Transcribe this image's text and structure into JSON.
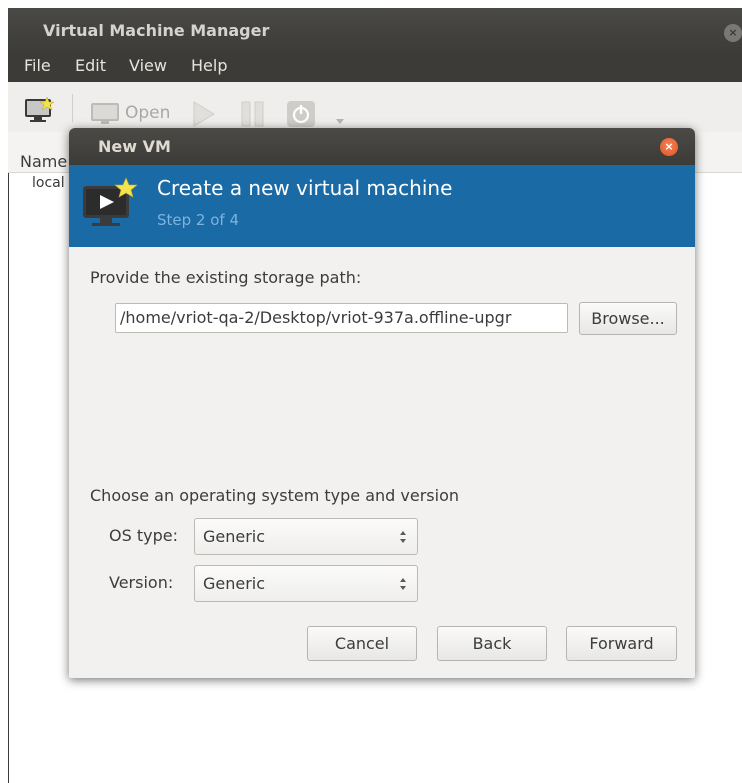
{
  "window": {
    "title": "Virtual Machine Manager",
    "close_glyph": "×"
  },
  "menubar": {
    "items": [
      {
        "label": "File"
      },
      {
        "label": "Edit"
      },
      {
        "label": "View"
      },
      {
        "label": "Help"
      }
    ]
  },
  "toolbar": {
    "open_label": "Open",
    "icons": [
      "new-vm-icon",
      "open-monitor-icon",
      "play-icon",
      "pause-icon",
      "power-icon",
      "dropdown-arrow-icon"
    ]
  },
  "list": {
    "column_header": "Name",
    "rows": [
      {
        "label": "local"
      }
    ]
  },
  "dialog": {
    "title": "New VM",
    "close_glyph": "×",
    "header": {
      "title": "Create a new virtual machine",
      "step": "Step 2 of 4"
    },
    "storage": {
      "label": "Provide the existing storage path:",
      "value": "/home/vriot-qa-2/Desktop/vriot-937a.offline-upgr",
      "browse_label": "Browse..."
    },
    "os": {
      "section_label": "Choose an operating system type and version",
      "type_label": "OS type:",
      "type_value": "Generic",
      "version_label": "Version:",
      "version_value": "Generic"
    },
    "buttons": {
      "cancel": "Cancel",
      "back": "Back",
      "forward": "Forward"
    }
  },
  "colors": {
    "header_blue": "#1a6aa5",
    "step_text": "#7fb2dc",
    "titlebar_dark": "#3c3b37",
    "close_orange": "#e0541f"
  }
}
